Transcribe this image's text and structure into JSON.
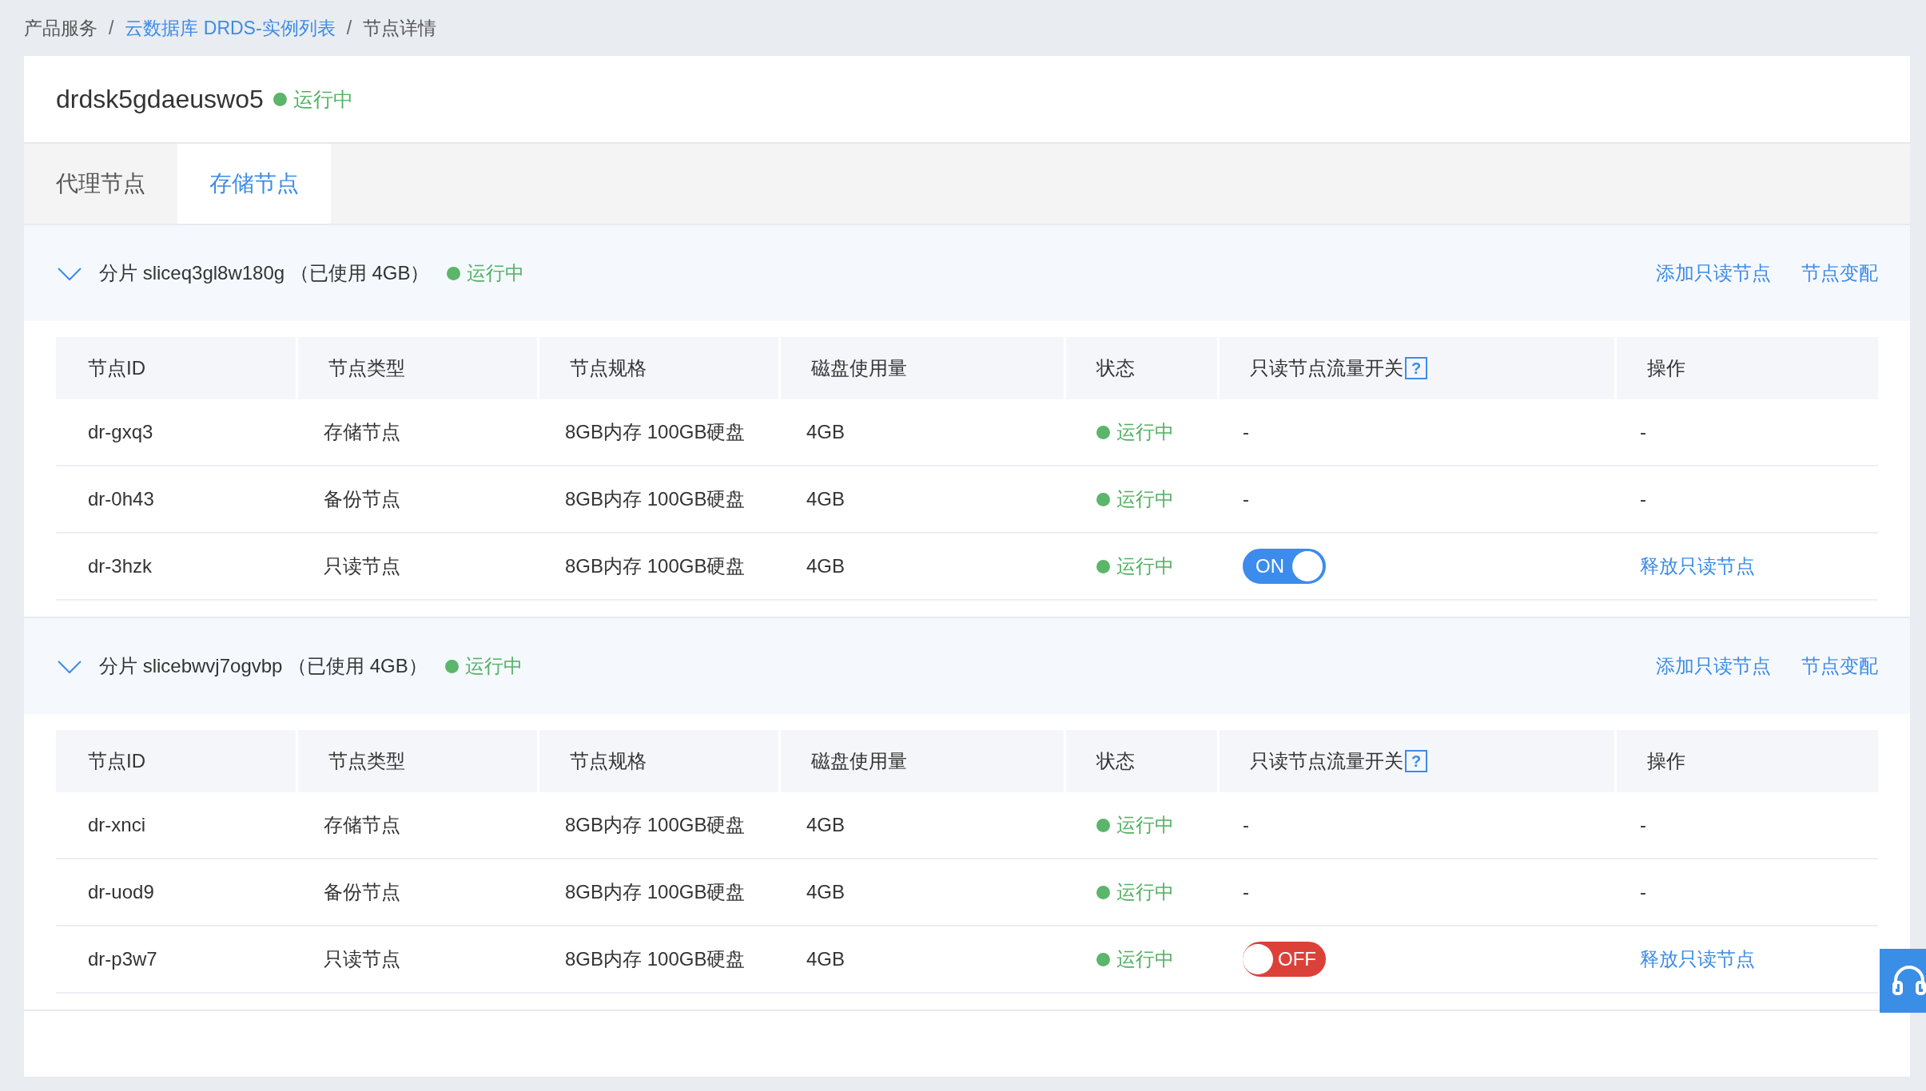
{
  "breadcrumb": [
    {
      "text": "产品服务",
      "link": false,
      "separator": "/"
    },
    {
      "text": "云数据库 DRDS-实例列表",
      "link": true,
      "separator": "/"
    },
    {
      "text": "节点详情",
      "link": false
    }
  ],
  "instance": {
    "name": "drdsk5gdaeuswo5",
    "status": "运行中"
  },
  "tabs": [
    {
      "label": "代理节点",
      "selected": false
    },
    {
      "label": "存储节点",
      "selected": true
    }
  ],
  "slices": [
    {
      "title": "分片 sliceq3gl8w180g （已使用 4GB）",
      "expanded": true,
      "status": "运行中",
      "actions": [
        "添加只读节点",
        "节点变配"
      ],
      "columns": [
        {
          "label": "节点ID"
        },
        {
          "label": "节点类型"
        },
        {
          "label": "节点规格"
        },
        {
          "label": "磁盘使用量"
        },
        {
          "label": "状态"
        },
        {
          "label": "只读节点流量开关",
          "help": "?"
        },
        {
          "label": "操作"
        }
      ],
      "rows": [
        {
          "node_id": "dr-gxq3",
          "type": "存储节点",
          "spec": "8GB内存 100GB硬盘",
          "disk": "4GB",
          "status": "运行中",
          "flow_switch": {
            "kind": "text",
            "text": "-"
          },
          "operation": {
            "kind": "text",
            "text": "-"
          }
        },
        {
          "node_id": "dr-0h43",
          "type": "备份节点",
          "spec": "8GB内存 100GB硬盘",
          "disk": "4GB",
          "status": "运行中",
          "flow_switch": {
            "kind": "text",
            "text": "-"
          },
          "operation": {
            "kind": "text",
            "text": "-"
          }
        },
        {
          "node_id": "dr-3hzk",
          "type": "只读节点",
          "spec": "8GB内存 100GB硬盘",
          "disk": "4GB",
          "status": "运行中",
          "flow_switch": {
            "kind": "toggle",
            "on": true,
            "label": "ON"
          },
          "operation": {
            "kind": "link",
            "text": "释放只读节点"
          }
        }
      ]
    },
    {
      "title": "分片 slicebwvj7ogvbp （已使用 4GB）",
      "expanded": true,
      "status": "运行中",
      "actions": [
        "添加只读节点",
        "节点变配"
      ],
      "columns": [
        {
          "label": "节点ID"
        },
        {
          "label": "节点类型"
        },
        {
          "label": "节点规格"
        },
        {
          "label": "磁盘使用量"
        },
        {
          "label": "状态"
        },
        {
          "label": "只读节点流量开关",
          "help": "?"
        },
        {
          "label": "操作"
        }
      ],
      "rows": [
        {
          "node_id": "dr-xnci",
          "type": "存储节点",
          "spec": "8GB内存 100GB硬盘",
          "disk": "4GB",
          "status": "运行中",
          "flow_switch": {
            "kind": "text",
            "text": "-"
          },
          "operation": {
            "kind": "text",
            "text": "-"
          }
        },
        {
          "node_id": "dr-uod9",
          "type": "备份节点",
          "spec": "8GB内存 100GB硬盘",
          "disk": "4GB",
          "status": "运行中",
          "flow_switch": {
            "kind": "text",
            "text": "-"
          },
          "operation": {
            "kind": "text",
            "text": "-"
          }
        },
        {
          "node_id": "dr-p3w7",
          "type": "只读节点",
          "spec": "8GB内存 100GB硬盘",
          "disk": "4GB",
          "status": "运行中",
          "flow_switch": {
            "kind": "toggle",
            "on": false,
            "label": "OFF"
          },
          "operation": {
            "kind": "link",
            "text": "释放只读节点"
          }
        }
      ]
    }
  ]
}
